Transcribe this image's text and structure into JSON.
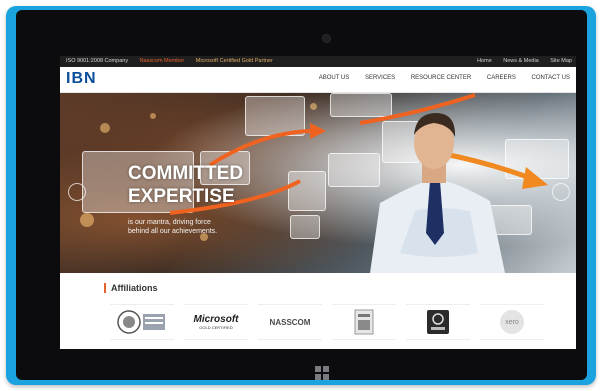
{
  "topbar": {
    "iso": "ISO 9001:2008 Company",
    "nasscom_member": "Nasscom Member",
    "microsoft_partner": "Microsoft Certified Gold Partner",
    "links": [
      "Home",
      "News & Media",
      "Site Map"
    ]
  },
  "brand": {
    "logo_text": "IBN",
    "color": "#0b4e9a"
  },
  "nav": {
    "items": [
      "ABOUT US",
      "SERVICES",
      "RESOURCE CENTER",
      "CAREERS",
      "CONTACT US"
    ]
  },
  "hero": {
    "headline_line1": "COMMITTED",
    "headline_line2": "EXPERTISE",
    "tagline_line1": "is our mantra, driving force",
    "tagline_line2": "behind all our achievements."
  },
  "affiliations": {
    "title": "Affiliations",
    "logos": [
      {
        "icon": "iso-certification-logo"
      },
      {
        "name": "Microsoft",
        "sub": "GOLD CERTIFIED"
      },
      {
        "name": "NASSCOM"
      },
      {
        "icon": "intuit-logo"
      },
      {
        "icon": "wave-logo"
      },
      {
        "name": "xero"
      }
    ]
  },
  "colors": {
    "tablet_frame": "#1ba3e0",
    "accent_orange": "#e8632a",
    "topbar_bg": "#1f1f1f"
  }
}
